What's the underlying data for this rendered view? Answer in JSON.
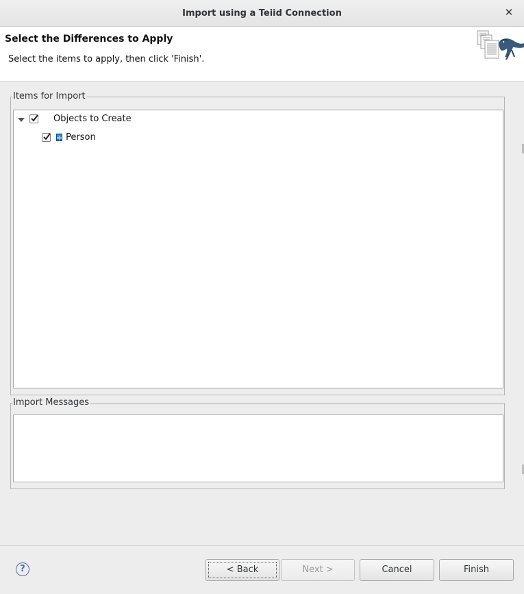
{
  "window": {
    "title": "Import using a Teiid Connection",
    "close_symbol": "✕"
  },
  "banner": {
    "heading": "Select the Differences to Apply",
    "description": "Select the items to apply, then click 'Finish'."
  },
  "items_group": {
    "legend": "Items for Import",
    "tree": [
      {
        "label": "Objects to Create",
        "checked": true,
        "expanded": true,
        "icon": "none"
      },
      {
        "label": "Person",
        "checked": true,
        "icon": "table-icon"
      }
    ]
  },
  "messages_group": {
    "legend": "Import Messages",
    "content": ""
  },
  "footer": {
    "help_symbol": "?",
    "back_label": "< Back",
    "next_label": "Next >",
    "cancel_label": "Cancel",
    "finish_label": "Finish"
  },
  "colors": {
    "table_icon": "#1f7fc0",
    "help": "#4a6da7"
  }
}
